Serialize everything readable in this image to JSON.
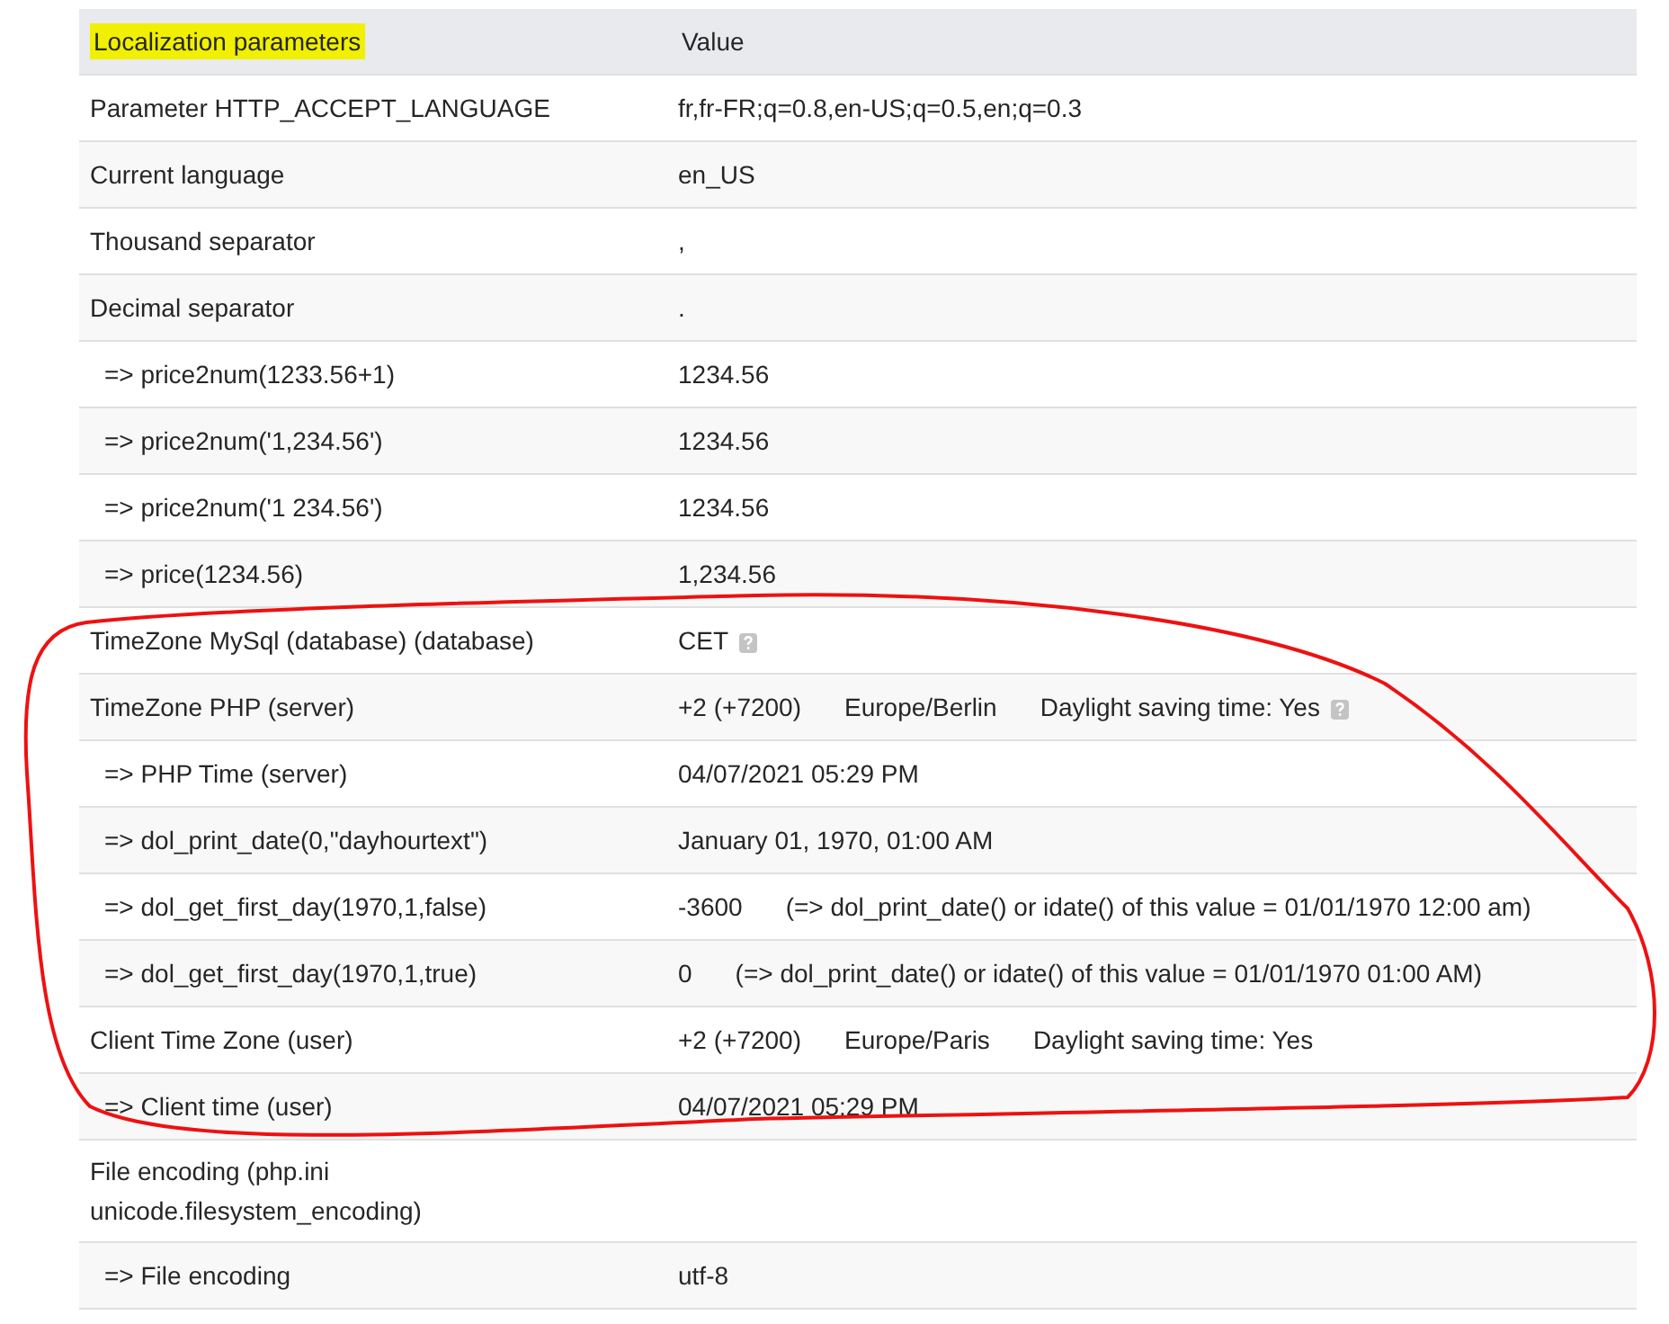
{
  "table": {
    "columns": [
      {
        "label": "Localization parameters",
        "highlighted": true
      },
      {
        "label": "Value",
        "highlighted": false
      }
    ],
    "rows": [
      {
        "label": "Parameter HTTP_ACCEPT_LANGUAGE",
        "values": [
          "fr,fr-FR;q=0.8,en-US;q=0.5,en;q=0.3"
        ],
        "help": false
      },
      {
        "label": "Current language",
        "values": [
          "en_US"
        ],
        "help": false
      },
      {
        "label": "Thousand separator",
        "values": [
          ","
        ],
        "help": false
      },
      {
        "label": "Decimal separator",
        "values": [
          "."
        ],
        "help": false,
        "children": [
          {
            "label": "=> price2num(1233.56+1)",
            "values": [
              "1234.56"
            ],
            "help": false
          },
          {
            "label": "=> price2num('1,234.56')",
            "values": [
              "1234.56"
            ],
            "help": false
          },
          {
            "label": "=> price2num('1 234.56')",
            "values": [
              "1234.56"
            ],
            "help": false
          },
          {
            "label": "=> price(1234.56)",
            "values": [
              "1,234.56"
            ],
            "help": false
          }
        ]
      },
      {
        "label": "TimeZone MySql (database) (database)",
        "values": [
          "CET"
        ],
        "help": true
      },
      {
        "label": "TimeZone PHP (server)",
        "values": [
          "+2 (+7200)",
          "Europe/Berlin",
          "Daylight saving time: Yes"
        ],
        "help": true,
        "children": [
          {
            "label": "=> PHP Time (server)",
            "values": [
              "04/07/2021 05:29 PM"
            ],
            "help": false
          },
          {
            "label": "=> dol_print_date(0,\"dayhourtext\")",
            "values": [
              "January 01, 1970, 01:00 AM"
            ],
            "help": false
          },
          {
            "label": "=> dol_get_first_day(1970,1,false)",
            "values": [
              "-3600",
              "(=> dol_print_date() or idate() of this value = 01/01/1970 12:00 am)"
            ],
            "help": false
          },
          {
            "label": "=> dol_get_first_day(1970,1,true)",
            "values": [
              "0",
              "(=> dol_print_date() or idate() of this value = 01/01/1970 01:00 AM)"
            ],
            "help": false
          }
        ]
      },
      {
        "label": "Client Time Zone (user)",
        "values": [
          "+2 (+7200)",
          "Europe/Paris",
          "Daylight saving time: Yes"
        ],
        "help": false,
        "children": [
          {
            "label": "=> Client time (user)",
            "values": [
              "04/07/2021 05:29 PM"
            ],
            "help": false
          }
        ]
      },
      {
        "label": "File encoding (php.ini unicode.filesystem_encoding)",
        "values": [],
        "help": false,
        "children": [
          {
            "label": "=> File encoding",
            "values": [
              "utf-8"
            ],
            "help": false
          }
        ]
      }
    ]
  },
  "annotation": {
    "kind": "loop"
  }
}
